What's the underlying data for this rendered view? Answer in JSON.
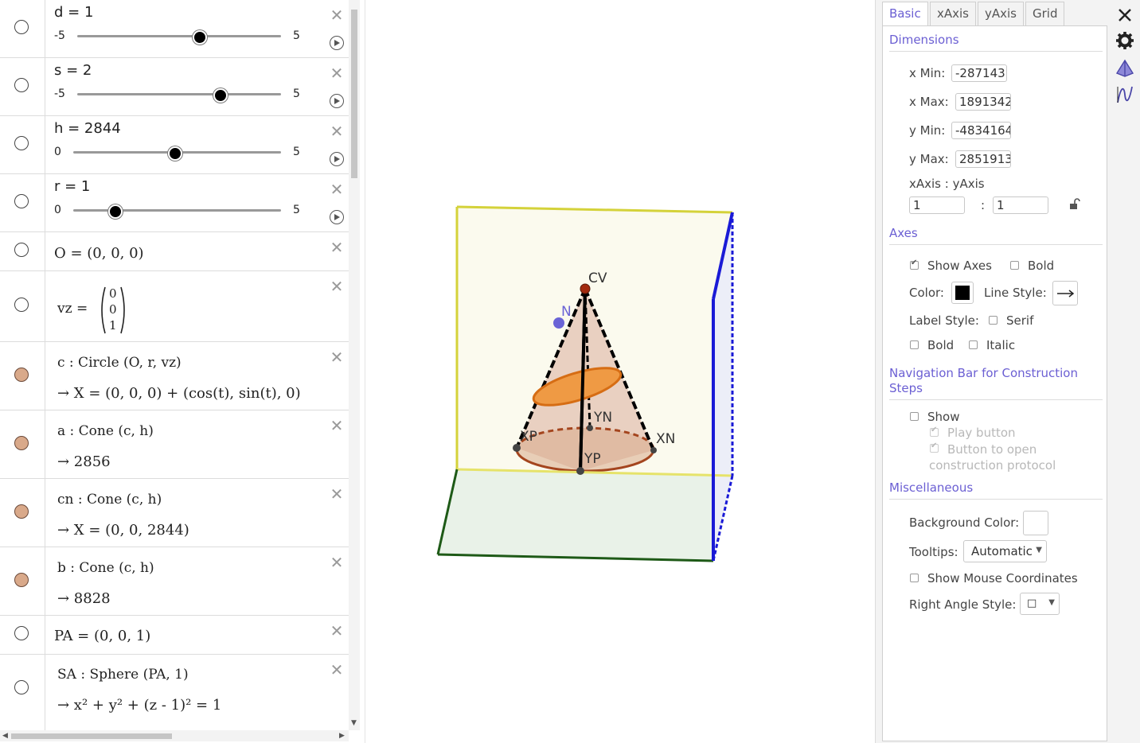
{
  "algebra": {
    "sliders": [
      {
        "label": "d = 1",
        "min": "-5",
        "max": "5",
        "value_fraction": 0.6
      },
      {
        "label": "s = 2",
        "min": "-5",
        "max": "5",
        "value_fraction": 0.7
      },
      {
        "label": "h = 2844",
        "min": "0",
        "max": "5",
        "value_fraction": 0.49
      },
      {
        "label": "r = 1",
        "min": "0",
        "max": "5",
        "value_fraction": 0.2
      }
    ],
    "point_o": "O = (0, 0, 0)",
    "vz": {
      "name": "vz =",
      "entries": [
        "0",
        "0",
        "1"
      ]
    },
    "circle": {
      "def": "c : Circle (O, r, vz)",
      "value": "→  X = (0, 0, 0) + (cos(t), sin(t), 0)"
    },
    "cone_a": {
      "def": "a : Cone (c, h)",
      "value": "→  2856"
    },
    "cone_cn": {
      "def": "cn : Cone (c, h)",
      "value": "→  X = (0, 0, 2844)"
    },
    "cone_b": {
      "def": "b : Cone (c, h)",
      "value": "→  8828"
    },
    "point_pa": "PA = (0, 0, 1)",
    "sphere": {
      "def": "SA : Sphere (PA, 1)",
      "value": "→  x² + y² + (z - 1)² = 1"
    }
  },
  "graphics": {
    "labels": {
      "cv": "CV",
      "n": "N",
      "yn": "YN",
      "xn": "XN",
      "yp": "YP",
      "xp": "XP"
    }
  },
  "properties": {
    "tabs": [
      "Basic",
      "xAxis",
      "yAxis",
      "Grid"
    ],
    "active_tab": "Basic",
    "dimensions": {
      "title": "Dimensions",
      "xmin_label": "x Min:",
      "xmin": "-287143",
      "xmax_label": "x Max:",
      "xmax": "1891342",
      "ymin_label": "y Min:",
      "ymin": "-4834164",
      "ymax_label": "y Max:",
      "ymax": "2851913",
      "ratio_label": "xAxis : yAxis",
      "ratio_x": "1",
      "ratio_sep": ":",
      "ratio_y": "1"
    },
    "axes": {
      "title": "Axes",
      "show_axes": "Show Axes",
      "show_axes_checked": true,
      "bold": "Bold",
      "bold_checked": false,
      "color_label": "Color:",
      "color": "#000000",
      "line_style_label": "Line Style:",
      "label_style_label": "Label Style:",
      "serif": "Serif",
      "label_bold": "Bold",
      "italic": "Italic"
    },
    "navbar": {
      "title": "Navigation Bar for Construction Steps",
      "show": "Show",
      "play_button": "Play button",
      "open_protocol": "Button to open construction protocol"
    },
    "misc": {
      "title": "Miscellaneous",
      "bg_color_label": "Background Color:",
      "tooltips_label": "Tooltips:",
      "tooltips_value": "Automatic",
      "show_mouse_coords": "Show Mouse Coordinates",
      "right_angle_label": "Right Angle Style:",
      "right_angle_value": "□"
    }
  },
  "colors": {
    "accent": "#6b5fd3",
    "cone_fill": "#d9a98a",
    "ellipse": "#ee8a2e"
  }
}
